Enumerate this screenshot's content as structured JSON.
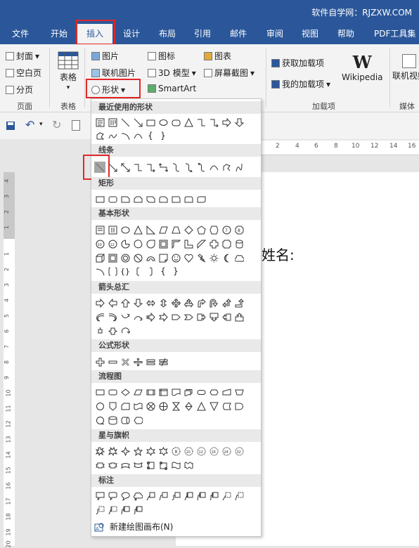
{
  "watermark": "软件自学网：RJZXW.COM",
  "tabs": [
    "文件",
    "开始",
    "插入",
    "设计",
    "布局",
    "引用",
    "邮件",
    "审阅",
    "视图",
    "帮助",
    "PDF工具集"
  ],
  "ribbon": {
    "cover": "封面",
    "blank": "空白页",
    "pagebreak": "分页",
    "group_page": "页面",
    "table": "表格",
    "group_table": "表格",
    "picture": "图片",
    "online_picture": "联机图片",
    "shapes": "形状",
    "icons": "图标",
    "model3d": "3D 模型",
    "smartart": "SmartArt",
    "chart": "图表",
    "screenshot": "屏幕截图",
    "get_addins": "获取加载项",
    "my_addins": "我的加载项",
    "wikipedia": "Wikipedia",
    "group_addins": "加载项",
    "online_video": "联机视频",
    "group_media": "媒体"
  },
  "ruler_ticks": [
    "2",
    "4",
    "6",
    "8",
    "10",
    "12",
    "14",
    "16"
  ],
  "vruler_ticks": [
    "4",
    "3",
    "2",
    "1",
    "1",
    "2",
    "3",
    "4",
    "5",
    "6",
    "7",
    "8",
    "9",
    "10",
    "11",
    "12",
    "13",
    "14",
    "15",
    "16",
    "17",
    "18",
    "19",
    "20"
  ],
  "doc_text": "姓名:",
  "sections": [
    "最近使用的形状",
    "线条",
    "矩形",
    "基本形状",
    "箭头总汇",
    "公式形状",
    "流程图",
    "星与旗帜",
    "标注"
  ],
  "new_canvas": "新建绘图画布(N)",
  "colors": {
    "accent": "#2b579a",
    "highlight": "#e32727"
  }
}
